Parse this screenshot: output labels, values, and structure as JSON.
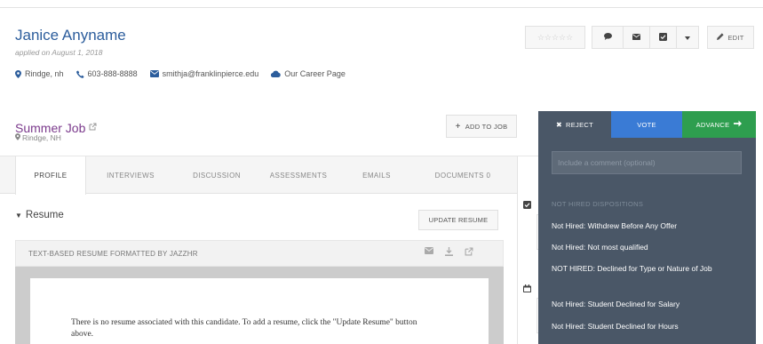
{
  "candidate": {
    "name": "Janice Anyname",
    "applied": "applied on August 1, 2018",
    "location": "Rindge, nh",
    "phone": "603-888-8888",
    "email": "smithja@franklinpierce.edu",
    "career_page": "Our Career Page"
  },
  "toolbar": {
    "stars": "☆☆☆☆☆",
    "edit_label": "EDIT"
  },
  "job": {
    "title": "Summer Job",
    "location": "Rindge, NH",
    "add_to_job_label": "ADD TO JOB"
  },
  "tabs": [
    {
      "label": "PROFILE",
      "active": true
    },
    {
      "label": "INTERVIEWS"
    },
    {
      "label": "DISCUSSION"
    },
    {
      "label": "ASSESSMENTS"
    },
    {
      "label": "EMAILS"
    },
    {
      "label": "DOCUMENTS 0"
    }
  ],
  "resume": {
    "section_title": "Resume",
    "update_label": "UPDATE RESUME",
    "bar_label": "TEXT-BASED RESUME FORMATTED BY JAZZHR",
    "body_text": "There is no resume associated with this candidate. To add a resume, click the \"Update Resume\" button above."
  },
  "actions": {
    "reject_label": "REJECT",
    "vote_label": "VOTE",
    "advance_label": "ADVANCE",
    "comment_placeholder": "Include a comment (optional)",
    "dispositions_heading": "NOT HIRED DISPOSITIONS",
    "dispositions": [
      "Not Hired: Withdrew Before Any Offer",
      "Not Hired: Not most qualified",
      "NOT HIRED: Declined for Type or Nature of Job",
      "Not Hired: Student Declined for Salary",
      "Not Hired: Student Declined for Hours"
    ]
  },
  "colors": {
    "name_link": "#2c5d9c",
    "job_title": "#7b3a8c",
    "reject_bg": "#4a5767",
    "vote_bg": "#3a7bd5",
    "advance_bg": "#2e9e4f"
  }
}
